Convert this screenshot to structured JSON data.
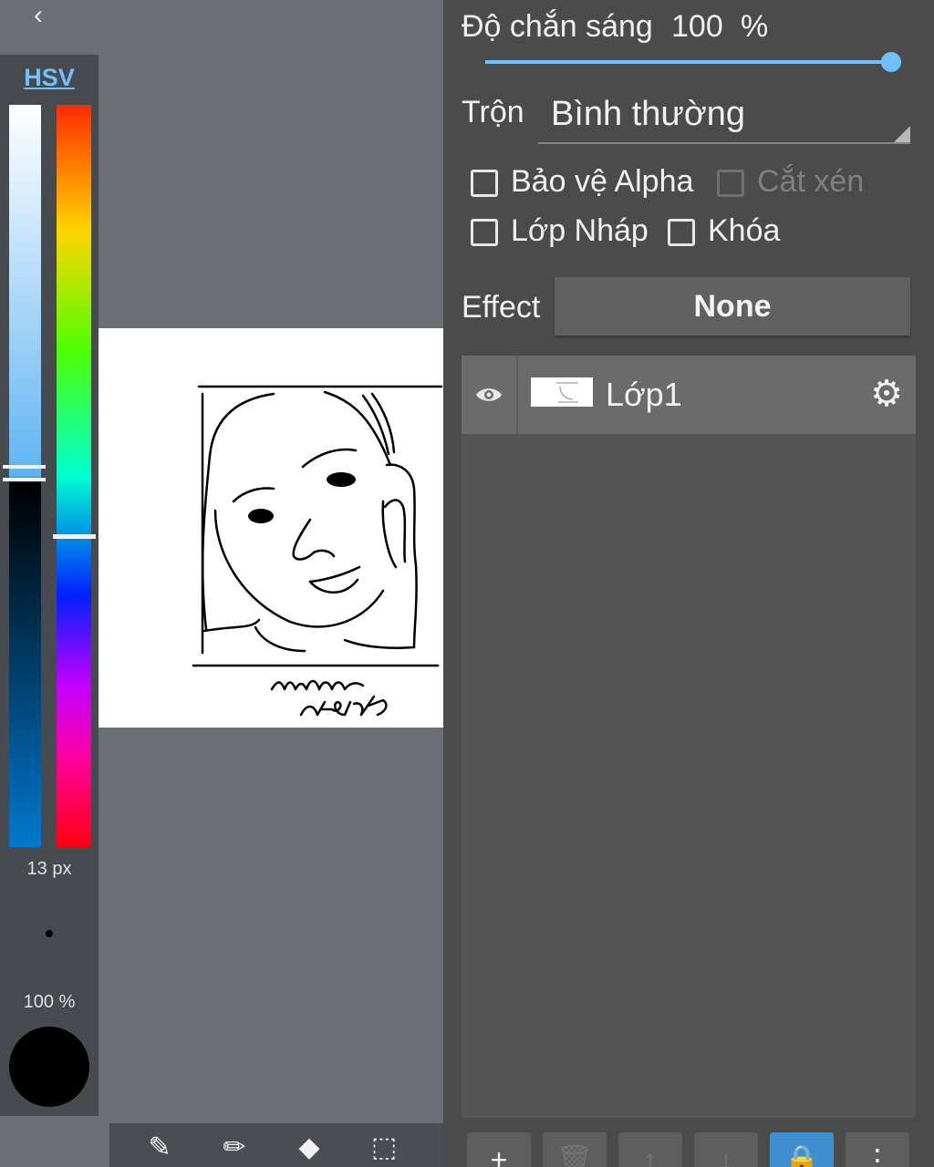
{
  "nav": {
    "back_glyph": "‹"
  },
  "color_panel": {
    "mode_tab": "HSV",
    "brush_size": "13 px",
    "brush_opacity": "100 %",
    "selected_color": "#000000",
    "value_level": 0.5,
    "hue_level": 0.58
  },
  "tools": {
    "eyedropper_glyph": "✎",
    "pen_glyph": "✏",
    "eraser_glyph": "◆",
    "select_glyph": "⬚"
  },
  "drawing": {
    "signature_line1": "minmin",
    "signature_line2": "arte2k7"
  },
  "layer_props": {
    "opacity_label": "Độ chắn sáng",
    "opacity_value": "100",
    "opacity_unit": "%",
    "opacity_level": 1.0,
    "blend_label": "Trộn",
    "blend_value": "Bình thường",
    "protect_alpha": "Bảo vệ Alpha",
    "clipping": "Cắt xén",
    "draft_layer": "Lớp Nháp",
    "lock": "Khóa",
    "effect_label": "Effect",
    "effect_value": "None"
  },
  "layers": [
    {
      "name": "Lớp1",
      "visible": true
    }
  ],
  "layer_actions": {
    "add_glyph": "+",
    "delete_glyph": "🗑",
    "up_glyph": "↑",
    "down_glyph": "↓",
    "lock_glyph": "🔒",
    "more_glyph": "⋮"
  },
  "colors": {
    "accent": "#6fc2ff",
    "panel_bg": "#4b4b4b",
    "canvas_bg": "#6b6e72",
    "active_button": "#3f8ed0"
  },
  "icons": [
    "back-icon",
    "eye-icon",
    "gear-icon",
    "eyedropper-icon",
    "pen-icon",
    "eraser-icon",
    "selection-icon",
    "add-icon",
    "trash-icon",
    "arrow-up-icon",
    "arrow-down-icon",
    "lock-icon",
    "more-icon"
  ]
}
